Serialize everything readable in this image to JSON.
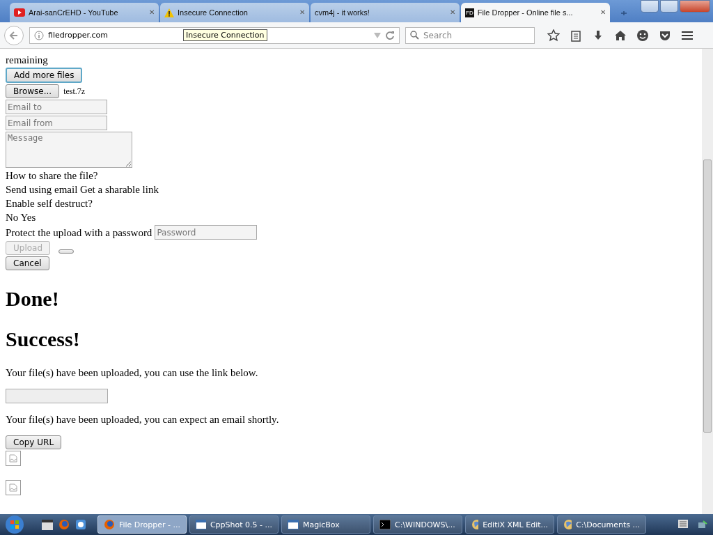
{
  "tabs": [
    {
      "title": "Arai-sanCrEHD - YouTube",
      "kind": "video",
      "close": "✕",
      "selected": false
    },
    {
      "title": "Insecure Connection",
      "kind": "warning",
      "close": "✕",
      "selected": false
    },
    {
      "title": "cvm4j - it works!",
      "kind": "plain",
      "close": "✕",
      "selected": false
    },
    {
      "title": "File Dropper - Online file s...",
      "kind": "badge",
      "badge_text": "FD",
      "close": "✕",
      "selected": true
    }
  ],
  "tooltip": "Insecure Connection",
  "address_bar": {
    "url": "filedropper.com"
  },
  "search": {
    "placeholder": "Search"
  },
  "page": {
    "remaining_text": "remaining",
    "add_files_button": "Add more files",
    "browse_button": "Browse...",
    "file_name": "test.7z",
    "email_to": {
      "placeholder": "Email to"
    },
    "email_from": {
      "placeholder": "Email from"
    },
    "message": {
      "placeholder": "Message"
    },
    "share_question": "How to share the file?",
    "share_options": "Send using email Get a sharable link",
    "self_destruct_question": "Enable self destruct?",
    "self_destruct_options": "No Yes",
    "password_label": "Protect the upload with a password",
    "password": {
      "placeholder": "Password"
    },
    "upload_button": {
      "label": "Upload",
      "disabled": true
    },
    "cancel_button": "Cancel",
    "heading_done": "Done!",
    "heading_success": "Success!",
    "link_message": "Your file(s) have been uploaded, you can use the link below.",
    "email_message": "Your file(s) have been uploaded, you can expect an email shortly.",
    "copy_url_button": "Copy URL"
  },
  "taskbar": [
    {
      "label": "File Dropper - ...",
      "kind": "firefox",
      "selected": true
    },
    {
      "label": "CppShot 0.5 - ...",
      "kind": "window",
      "selected": false
    },
    {
      "label": "MagicBox",
      "kind": "window",
      "selected": false
    },
    {
      "label": "C:\\WINDOWS\\...",
      "kind": "console",
      "selected": false
    },
    {
      "label": "EditiX XML Edit...",
      "kind": "globe",
      "selected": false
    },
    {
      "label": "C:\\Documents ...",
      "kind": "globe",
      "selected": false
    }
  ]
}
